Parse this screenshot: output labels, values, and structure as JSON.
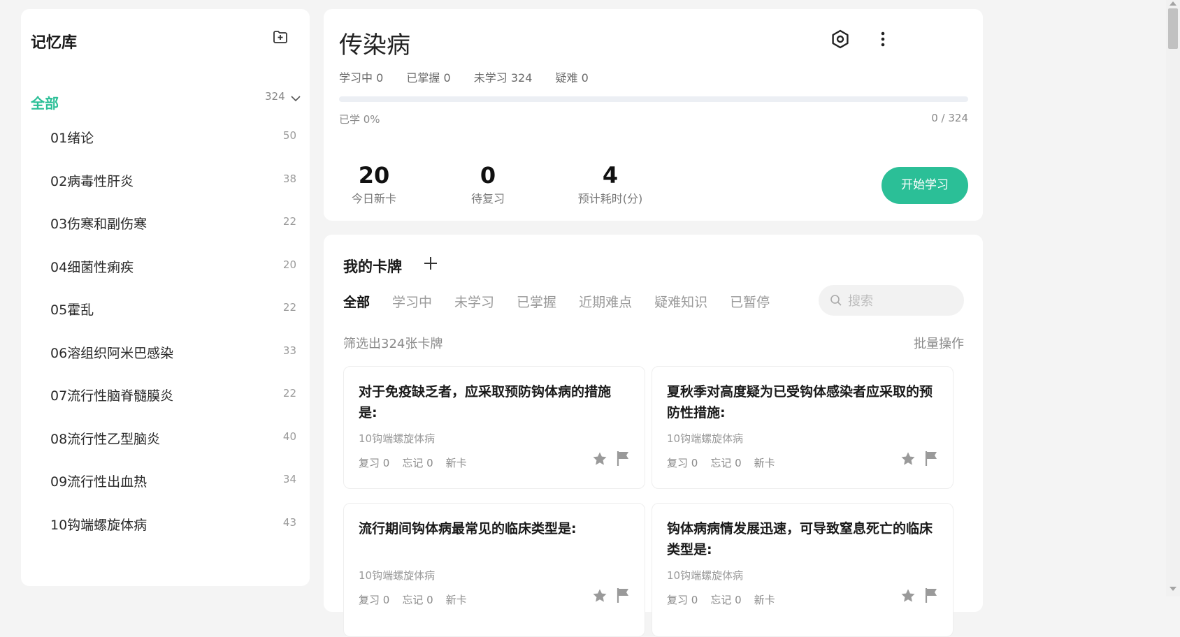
{
  "sidebar": {
    "title": "记忆库",
    "add_icon": "folder-add-icon",
    "all": {
      "label": "全部",
      "count": "324"
    },
    "items": [
      {
        "label": "01绪论",
        "count": "50"
      },
      {
        "label": "02病毒性肝炎",
        "count": "38"
      },
      {
        "label": "03伤寒和副伤寒",
        "count": "22"
      },
      {
        "label": "04细菌性痢疾",
        "count": "20"
      },
      {
        "label": "05霍乱",
        "count": "22"
      },
      {
        "label": "06溶组织阿米巴感染",
        "count": "33"
      },
      {
        "label": "07流行性脑脊髓膜炎",
        "count": "22"
      },
      {
        "label": "08流行性乙型脑炎",
        "count": "40"
      },
      {
        "label": "09流行性出血热",
        "count": "34"
      },
      {
        "label": "10钩端螺旋体病",
        "count": "43"
      }
    ]
  },
  "deck": {
    "title": "传染病",
    "stats": {
      "learning": "学习中 0",
      "mastered": "已掌握 0",
      "unlearned": "未学习 324",
      "difficult": "疑难 0"
    },
    "progress": 0,
    "learned_label": "已学 0%",
    "learned_count": "0 / 324",
    "metrics": [
      {
        "value": "20",
        "label": "今日新卡"
      },
      {
        "value": "0",
        "label": "待复习"
      },
      {
        "value": "4",
        "label": "预计耗时(分)"
      }
    ],
    "start_button": "开始学习"
  },
  "cards_panel": {
    "title": "我的卡牌",
    "tabs": [
      "全部",
      "学习中",
      "未学习",
      "已掌握",
      "近期难点",
      "疑难知识",
      "已暂停"
    ],
    "active_tab": 0,
    "search_placeholder": "搜索",
    "filter_text": "筛选出324张卡牌",
    "batch_label": "批量操作",
    "cards": [
      {
        "question": "对于免疫缺乏者，应采取预防钩体病的措施是:",
        "source": "10钩端螺旋体病",
        "review": "复习 0",
        "forget": "忘记 0",
        "status": "新卡"
      },
      {
        "question": "夏秋季对高度疑为已受钩体感染者应采取的预防性措施:",
        "source": "10钩端螺旋体病",
        "review": "复习 0",
        "forget": "忘记 0",
        "status": "新卡"
      },
      {
        "question": "流行期间钩体病最常见的临床类型是:",
        "source": "10钩端螺旋体病",
        "review": "复习 0",
        "forget": "忘记 0",
        "status": "新卡"
      },
      {
        "question": "钩体病病情发展迅速，可导致窒息死亡的临床类型是:",
        "source": "10钩端螺旋体病",
        "review": "复习 0",
        "forget": "忘记 0",
        "status": "新卡"
      }
    ]
  },
  "colors": {
    "accent": "#2bbf97",
    "icon_gray": "#9a9a9a"
  }
}
